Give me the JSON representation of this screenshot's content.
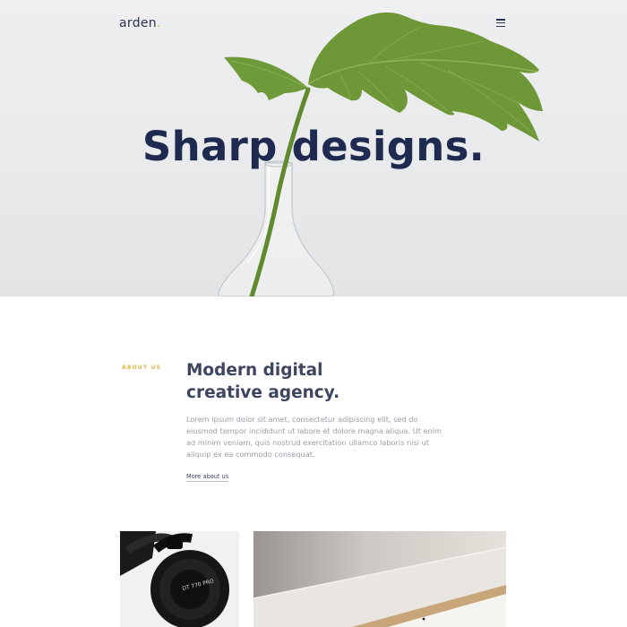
{
  "header": {
    "logo": "arden",
    "logo_dot": ".",
    "menu_icon": "hamburger-menu-icon"
  },
  "hero": {
    "title": "Sharp designs."
  },
  "about": {
    "label": "ABOUT US",
    "heading_line1": "Modern digital",
    "heading_line2": "creative agency.",
    "body": "Lorem ipsum dolor sit amet, consectetur adipiscing elit, sed do eiusmod tempor incididunt ut labore et dolore magna aliqua. Ut enim ad minim veniam, quis nostrud exercitation ullamco laboris nisi ut aliquip ex ea commodo consequat.",
    "link": "More about us"
  },
  "gallery": {
    "headphones_text": "DT 770 PRO"
  },
  "colors": {
    "navy": "#1f2a50",
    "accent": "#e0b64a",
    "body_text": "#9a9ea9"
  }
}
